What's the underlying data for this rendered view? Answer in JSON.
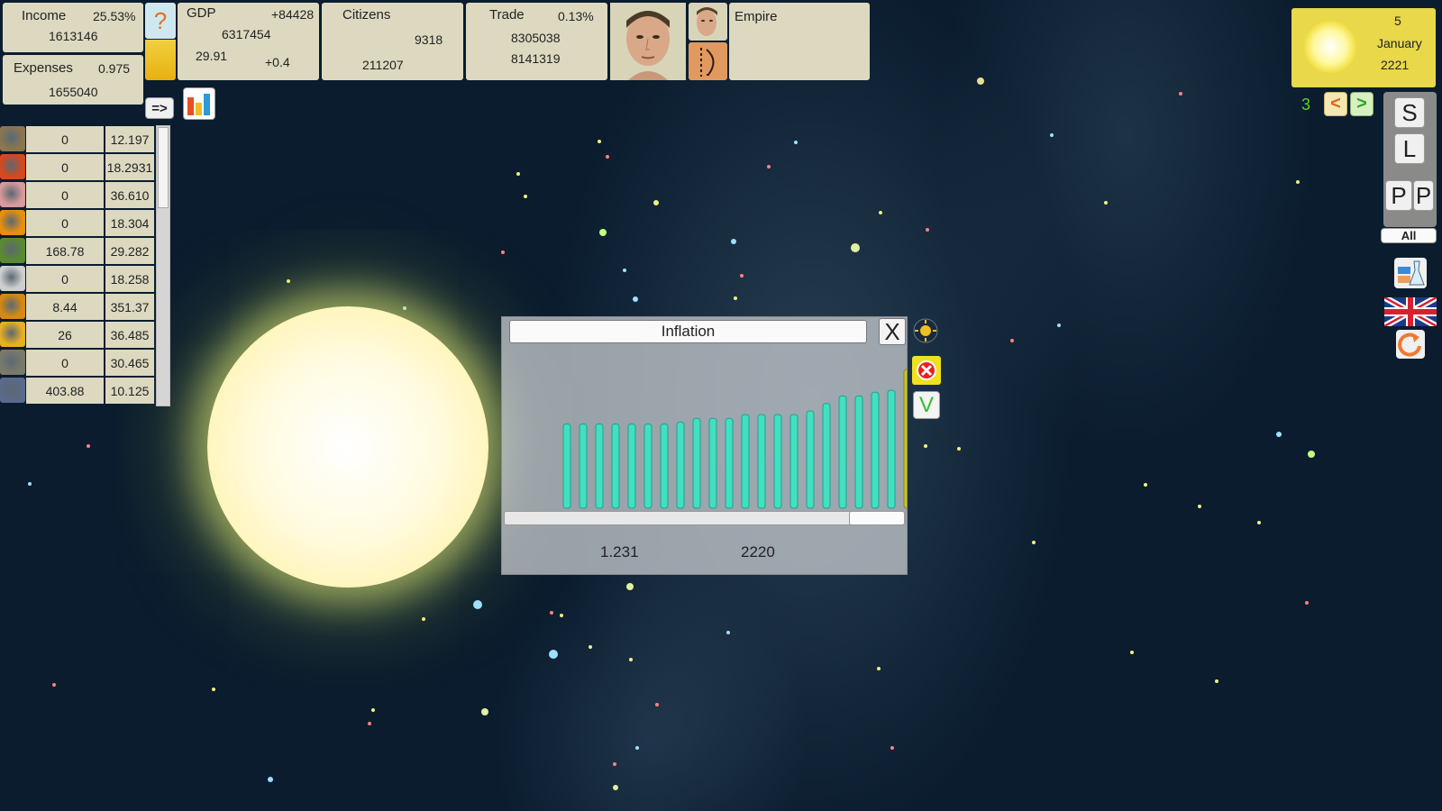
{
  "income": {
    "label": "Income",
    "percent": "25.53%",
    "value": "1613146"
  },
  "expenses": {
    "label": "Expenses",
    "ratio": "0.975",
    "value": "1655040"
  },
  "help_label": "?",
  "gdp": {
    "label": "GDP",
    "delta": "+84428",
    "value": "6317454",
    "left_value": "29.91",
    "right_value": "+0.4"
  },
  "citizens": {
    "label": "Citizens",
    "value1": "9318",
    "value2": "211207"
  },
  "trade": {
    "label": "Trade",
    "percent": "0.13%",
    "value1": "8305038",
    "value2": "8141319"
  },
  "empire_label": "Empire",
  "arrow_button_label": "=>",
  "date": {
    "day": "5",
    "month": "January",
    "year": "2221"
  },
  "speed": {
    "value": "3",
    "prev_label": "<",
    "next_label": ">"
  },
  "right_menu": {
    "save_label": "S",
    "load_label": "L",
    "p1_label": "P",
    "p2_label": "P",
    "all_label": "All"
  },
  "resources": [
    {
      "icon": "wheat-icon",
      "amount": "0",
      "price": "12.197",
      "color": "#8a7650"
    },
    {
      "icon": "tomato-icon",
      "amount": "0",
      "price": "18.2931",
      "color": "#d8481a"
    },
    {
      "icon": "meat-icon",
      "amount": "0",
      "price": "36.610",
      "color": "#d89a9a"
    },
    {
      "icon": "orange-icon",
      "amount": "0",
      "price": "18.304",
      "color": "#e8900e"
    },
    {
      "icon": "vegetables-icon",
      "amount": "168.78",
      "price": "29.282",
      "color": "#5a8a30"
    },
    {
      "icon": "cotton-icon",
      "amount": "0",
      "price": "18.258",
      "color": "#cfcfcf"
    },
    {
      "icon": "honey-icon",
      "amount": "8.44",
      "price": "351.37",
      "color": "#d88a10"
    },
    {
      "icon": "shirt-icon",
      "amount": "26",
      "price": "36.485",
      "color": "#e8b020"
    },
    {
      "icon": "wine-bottle-icon",
      "amount": "0",
      "price": "30.465",
      "color": "#7a7a6a"
    },
    {
      "icon": "ore-icon",
      "amount": "403.88",
      "price": "10.125",
      "color": "#5a6a8a"
    }
  ],
  "dialog": {
    "title": "Inflation",
    "close_label": "X",
    "confirm_label": "V",
    "footer_value": "1.231",
    "footer_year": "2220"
  },
  "chart_data": {
    "type": "bar",
    "title": "Inflation",
    "values": [
      1.085,
      1.085,
      1.085,
      1.085,
      1.085,
      1.085,
      1.085,
      1.09,
      1.1,
      1.1,
      1.1,
      1.11,
      1.11,
      1.11,
      1.11,
      1.12,
      1.14,
      1.16,
      1.16,
      1.17,
      1.175,
      1.231
    ],
    "highlight_last": true,
    "colors": {
      "bar": "#40e0c0",
      "highlight": "#c8c81a"
    }
  },
  "colors": {
    "panel": "#dcd9c0",
    "space": "#0a1c2e",
    "date_panel": "#e8d84a",
    "speed_text": "#5cd030"
  }
}
